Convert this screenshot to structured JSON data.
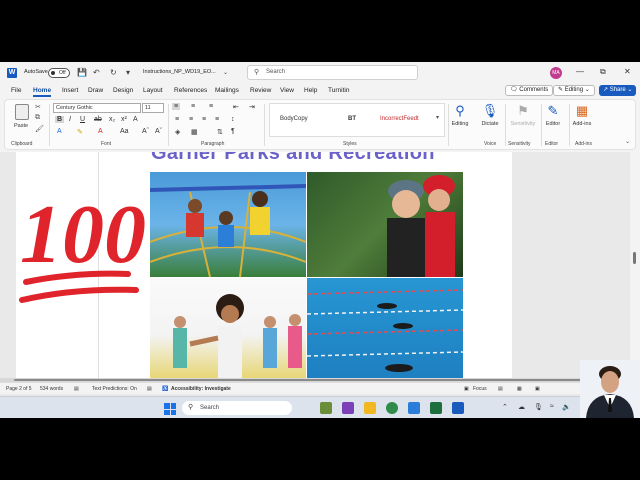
{
  "titlebar": {
    "autosave_label": "AutoSave",
    "autosave_state": "Off",
    "doc_title": "Instructions_NP_WD19_EO...",
    "search_placeholder": "Search",
    "avatar_initials": "MA"
  },
  "menu": {
    "tabs": [
      "File",
      "Home",
      "Insert",
      "Draw",
      "Design",
      "Layout",
      "References",
      "Mailings",
      "Review",
      "View",
      "Help",
      "Turnitin"
    ],
    "active_tab": "Home",
    "comments": "Comments",
    "editing": "Editing",
    "share": "Share"
  },
  "ribbon": {
    "paste_label": "Paste",
    "font_name": "Century Gothic",
    "font_size": "11",
    "styles": [
      "BodyCopy",
      "BT",
      "IncorrectFeedt"
    ],
    "groups": [
      "Clipboard",
      "Font",
      "Paragraph",
      "Styles",
      "Voice",
      "Sensitivity",
      "Editor",
      "Add-ins"
    ],
    "editing_label": "Editing",
    "dictate_label": "Dictate",
    "sensitivity_label": "Sensitivity",
    "editor_label": "Editor",
    "addins_label": "Add-ins"
  },
  "document": {
    "heading": "Garner Parks and Recreation",
    "emoji_text": "100"
  },
  "statusbar": {
    "page": "Page 2 of 5",
    "words": "534 words",
    "predictions": "Text Predictions: On",
    "accessibility": "Accessibility: Investigate",
    "focus": "Focus"
  },
  "taskbar": {
    "search_placeholder": "Search"
  },
  "colors": {
    "word_blue": "#185abd",
    "heading_purple": "#6a62c9",
    "emoji_red": "#e0242c"
  }
}
